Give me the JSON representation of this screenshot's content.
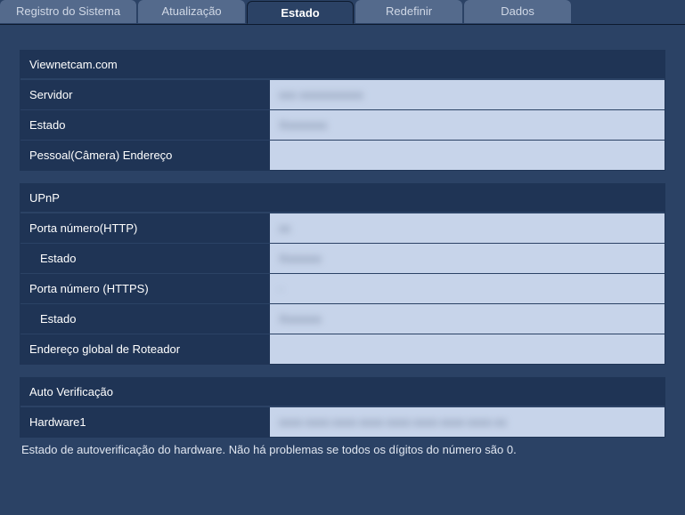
{
  "tabs": [
    {
      "label": "Registro do Sistema",
      "active": false
    },
    {
      "label": "Atualização",
      "active": false
    },
    {
      "label": "Estado",
      "active": true
    },
    {
      "label": "Redefinir",
      "active": false
    },
    {
      "label": "Dados",
      "active": false
    }
  ],
  "sections": {
    "viewnetcam": {
      "title": "Viewnetcam.com",
      "rows": {
        "server_label": "Servidor",
        "server_value": "xxx xxxxxxxxxxx",
        "status_label": "Estado",
        "status_value": "Xxxxxxxx",
        "personal_label": "Pessoal(Câmera) Endereço",
        "personal_value": ""
      }
    },
    "upnp": {
      "title": "UPnP",
      "rows": {
        "http_label": "Porta número(HTTP)",
        "http_value": "xx",
        "http_status_label": "Estado",
        "http_status_value": "Xxxxxxx",
        "https_label": "Porta número (HTTPS)",
        "https_value": "-",
        "https_status_label": "Estado",
        "https_status_value": "Xxxxxxx",
        "router_label": "Endereço global de Roteador",
        "router_value": ""
      }
    },
    "selfcheck": {
      "title": "Auto Verificação",
      "rows": {
        "hw1_label": "Hardware1",
        "hw1_value": "xxxx-xxxx-xxxx-xxxx-xxxx-xxxx-xxxx-xxxx-xx"
      }
    }
  },
  "footnote": "Estado de autoverificação do hardware. Não há problemas se todos os dígitos do número são 0."
}
